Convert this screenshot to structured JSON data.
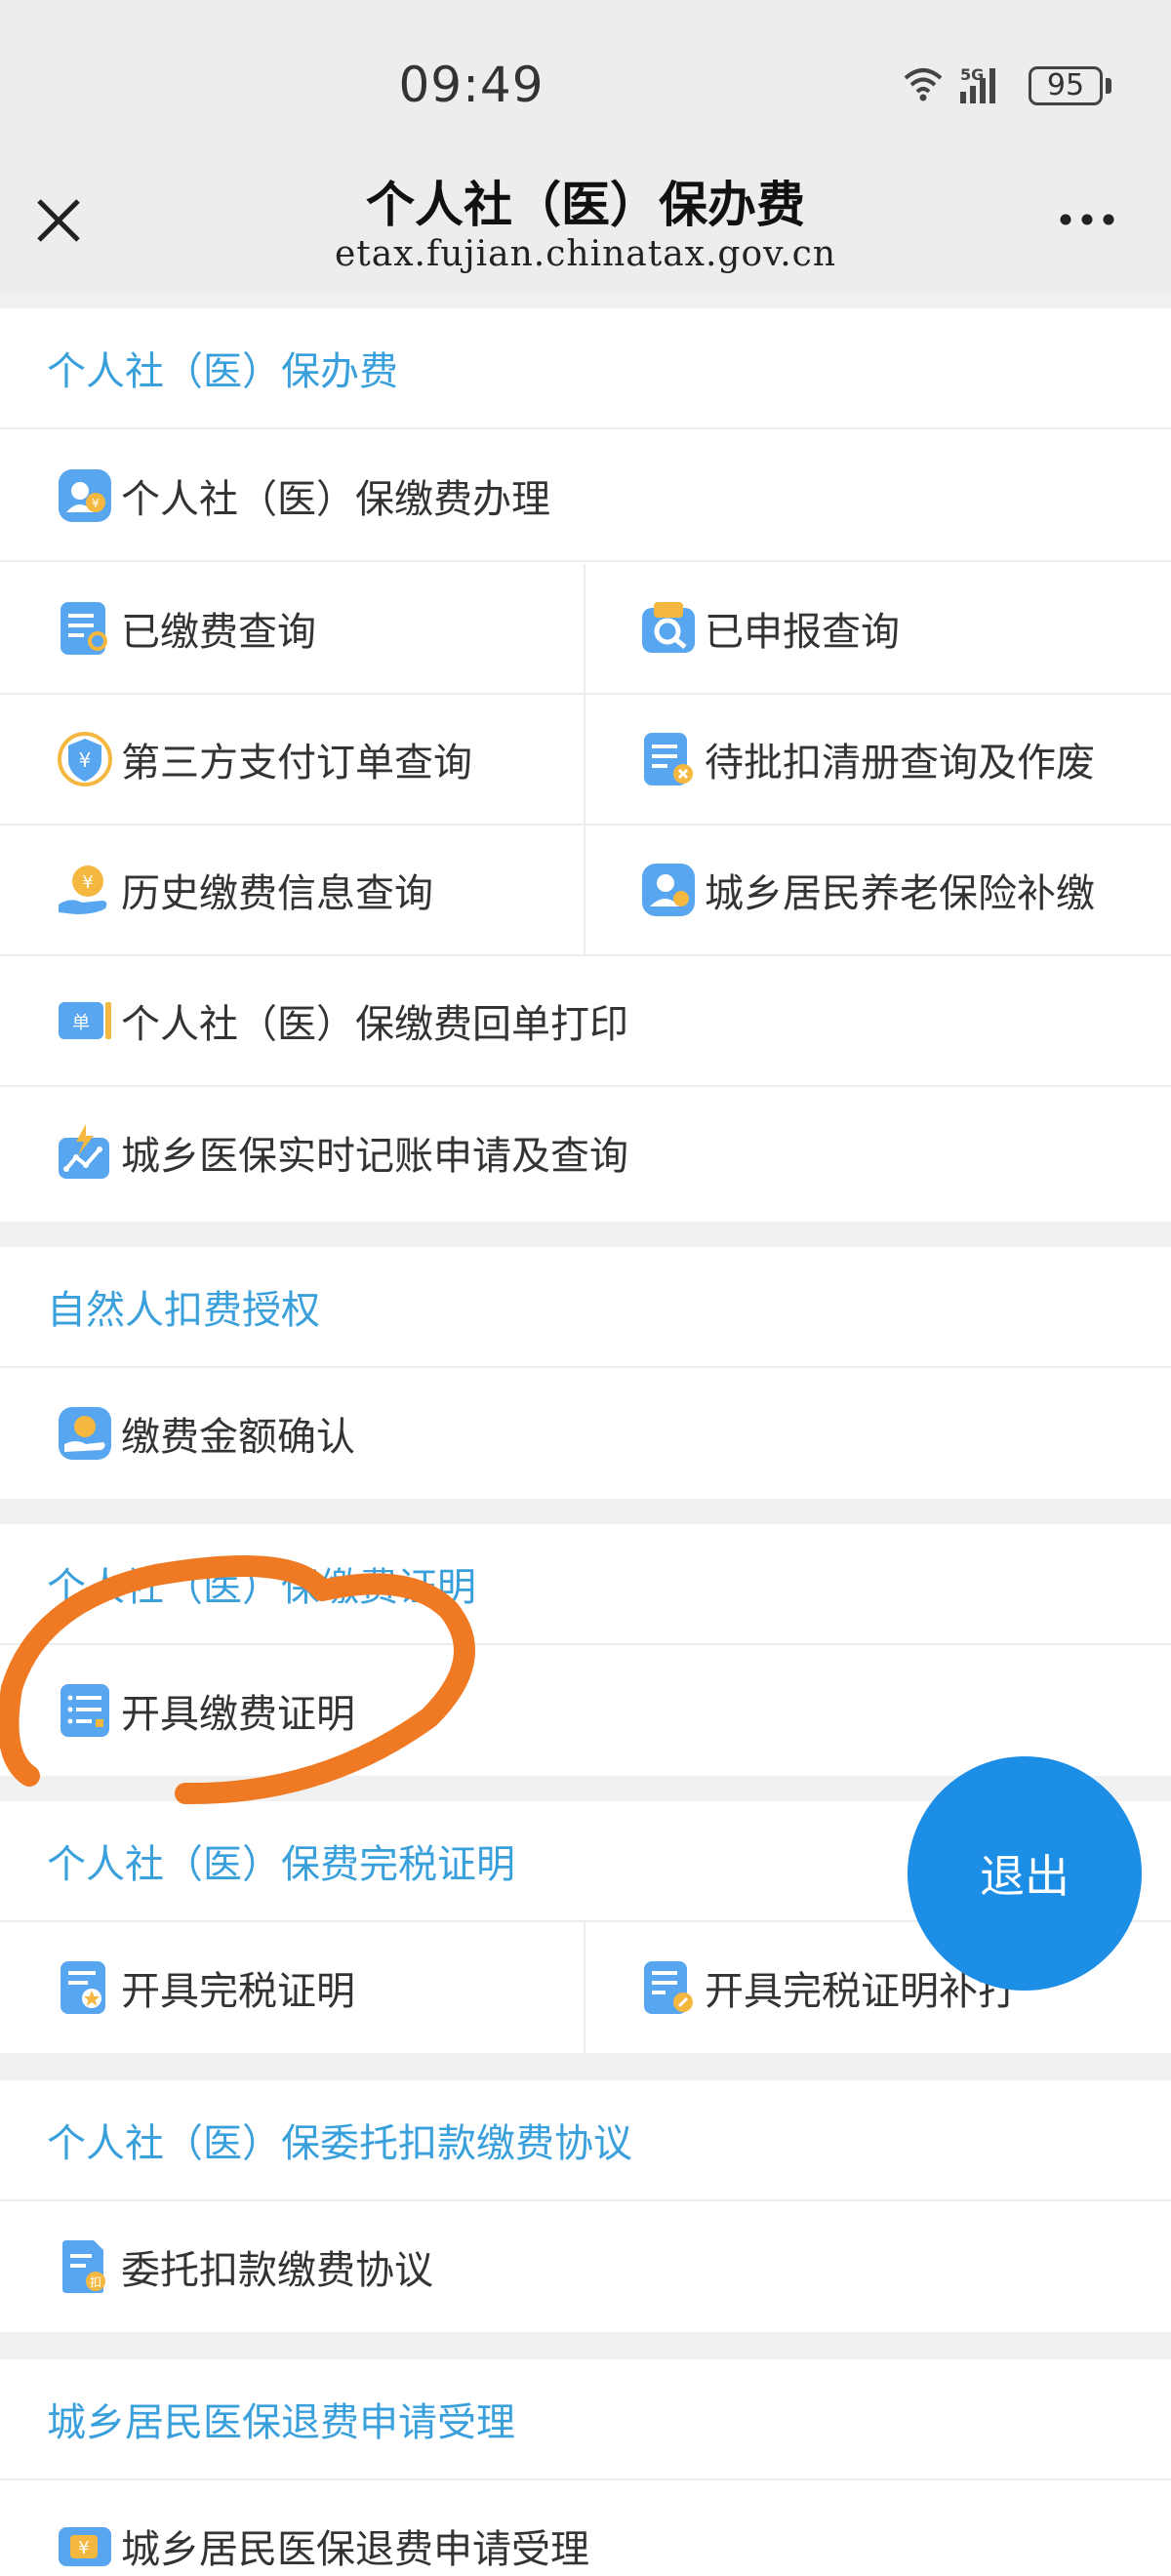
{
  "status_bar": {
    "time": "09:49",
    "network": "5G",
    "battery": "95"
  },
  "nav": {
    "title": "个人社（医）保办费",
    "url": "etax.fujian.chinatax.gov.cn"
  },
  "sections": [
    {
      "title": "个人社（医）保办费",
      "items": [
        {
          "label": "个人社（医）保缴费办理",
          "icon": "person-yuan-icon"
        },
        {
          "label": "已缴费查询",
          "icon": "document-search-icon"
        },
        {
          "label": "已申报查询",
          "icon": "magnifier-folder-icon"
        },
        {
          "label": "第三方支付订单查询",
          "icon": "shield-yuan-icon"
        },
        {
          "label": "待批扣清册查询及作废",
          "icon": "document-cancel-icon"
        },
        {
          "label": "历史缴费信息查询",
          "icon": "coin-hand-icon"
        },
        {
          "label": "城乡居民养老保险补缴",
          "icon": "elder-person-icon"
        },
        {
          "label": "个人社（医）保缴费回单打印",
          "icon": "receipt-icon",
          "icon_text": "单"
        },
        {
          "label": "城乡医保实时记账申请及查询",
          "icon": "flash-chart-icon"
        }
      ]
    },
    {
      "title": "自然人扣费授权",
      "items": [
        {
          "label": "缴费金额确认",
          "icon": "hand-coin-icon"
        }
      ]
    },
    {
      "title": "个人社（医）保缴费证明",
      "items": [
        {
          "label": "开具缴费证明",
          "icon": "list-document-icon"
        }
      ]
    },
    {
      "title": "个人社（医）保费完税证明",
      "items": [
        {
          "label": "开具完税证明",
          "icon": "certificate-star-icon"
        },
        {
          "label": "开具完税证明补打",
          "icon": "certificate-pen-icon"
        }
      ]
    },
    {
      "title": "个人社（医）保委托扣款缴费协议",
      "items": [
        {
          "label": "委托扣款缴费协议",
          "icon": "agreement-icon"
        }
      ]
    },
    {
      "title": "城乡居民医保退费申请受理",
      "items": [
        {
          "label": "城乡居民医保退费申请受理",
          "icon": "refund-yuan-icon",
          "icon_text": "¥"
        }
      ]
    }
  ],
  "exit_button": {
    "label": "退出"
  },
  "colors": {
    "accent": "#3aa0dc",
    "exit": "#1c8ee6",
    "annotation": "#f07a24"
  }
}
